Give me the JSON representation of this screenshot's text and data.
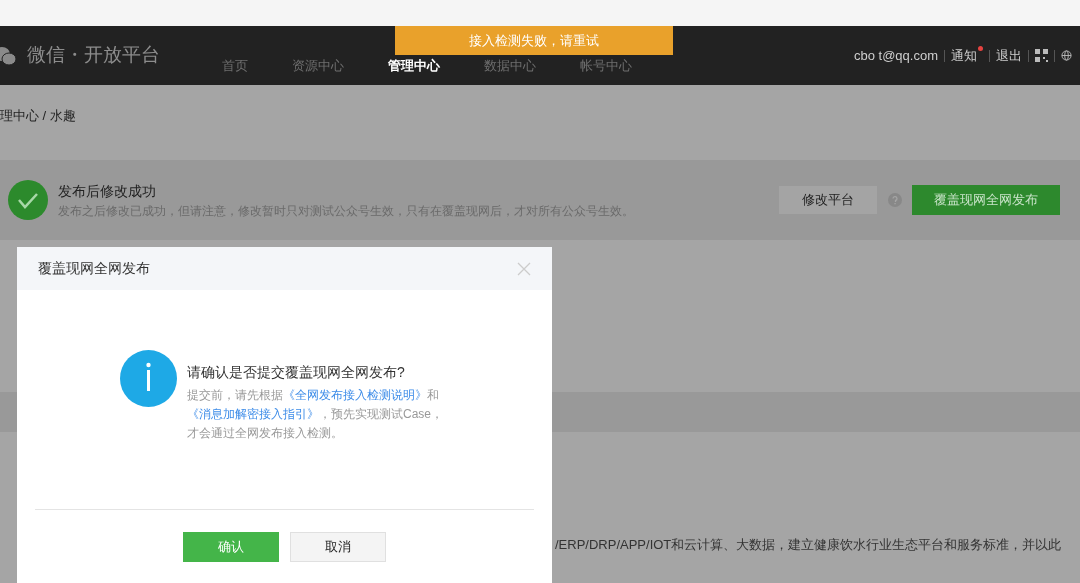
{
  "toast": {
    "text": "接入检测失败，请重试"
  },
  "nav": {
    "logo": "微信・开放平台",
    "items": [
      {
        "label": "首页",
        "selected": false
      },
      {
        "label": "资源中心",
        "selected": false
      },
      {
        "label": "管理中心",
        "selected": true
      },
      {
        "label": "数据中心",
        "selected": false
      },
      {
        "label": "帐号中心",
        "selected": false
      }
    ],
    "account": "cbo t@qq.com",
    "notify": "通知",
    "notify_unread": true,
    "logout": "退出"
  },
  "breadcrumb": "理中心 / 水趣",
  "status": {
    "title": "发布后修改成功",
    "description": "发布之后修改已成功，但请注意，修改暂时只对测试公众号生效，只有在覆盖现网后，才对所有公众号生效。",
    "buttons": [
      {
        "label": "修改平台",
        "kind": "secondary"
      },
      {
        "label": "覆盖现网全网发布",
        "kind": "primary"
      }
    ]
  },
  "body_text": "/ERP/DRP/APP/IOT和云计算、大数据，建立健康饮水行业生态平台和服务标准，并以此",
  "dialog": {
    "title": "覆盖现网全网发布",
    "heading": "请确认是否提交覆盖现网全网发布?",
    "description": [
      {
        "kind": "text",
        "text": "提交前，请先根据"
      },
      {
        "kind": "link",
        "text": "《全网发布接入检测说明》"
      },
      {
        "kind": "text",
        "text": "和"
      },
      {
        "kind": "link",
        "text": "《消息加解密接入指引》"
      },
      {
        "kind": "text",
        "text": "，预先实现测试Case，才会通过全网发布接入检测。"
      }
    ],
    "buttons": [
      {
        "label": "确认",
        "kind": "primary"
      },
      {
        "label": "取消",
        "kind": "secondary"
      }
    ]
  }
}
